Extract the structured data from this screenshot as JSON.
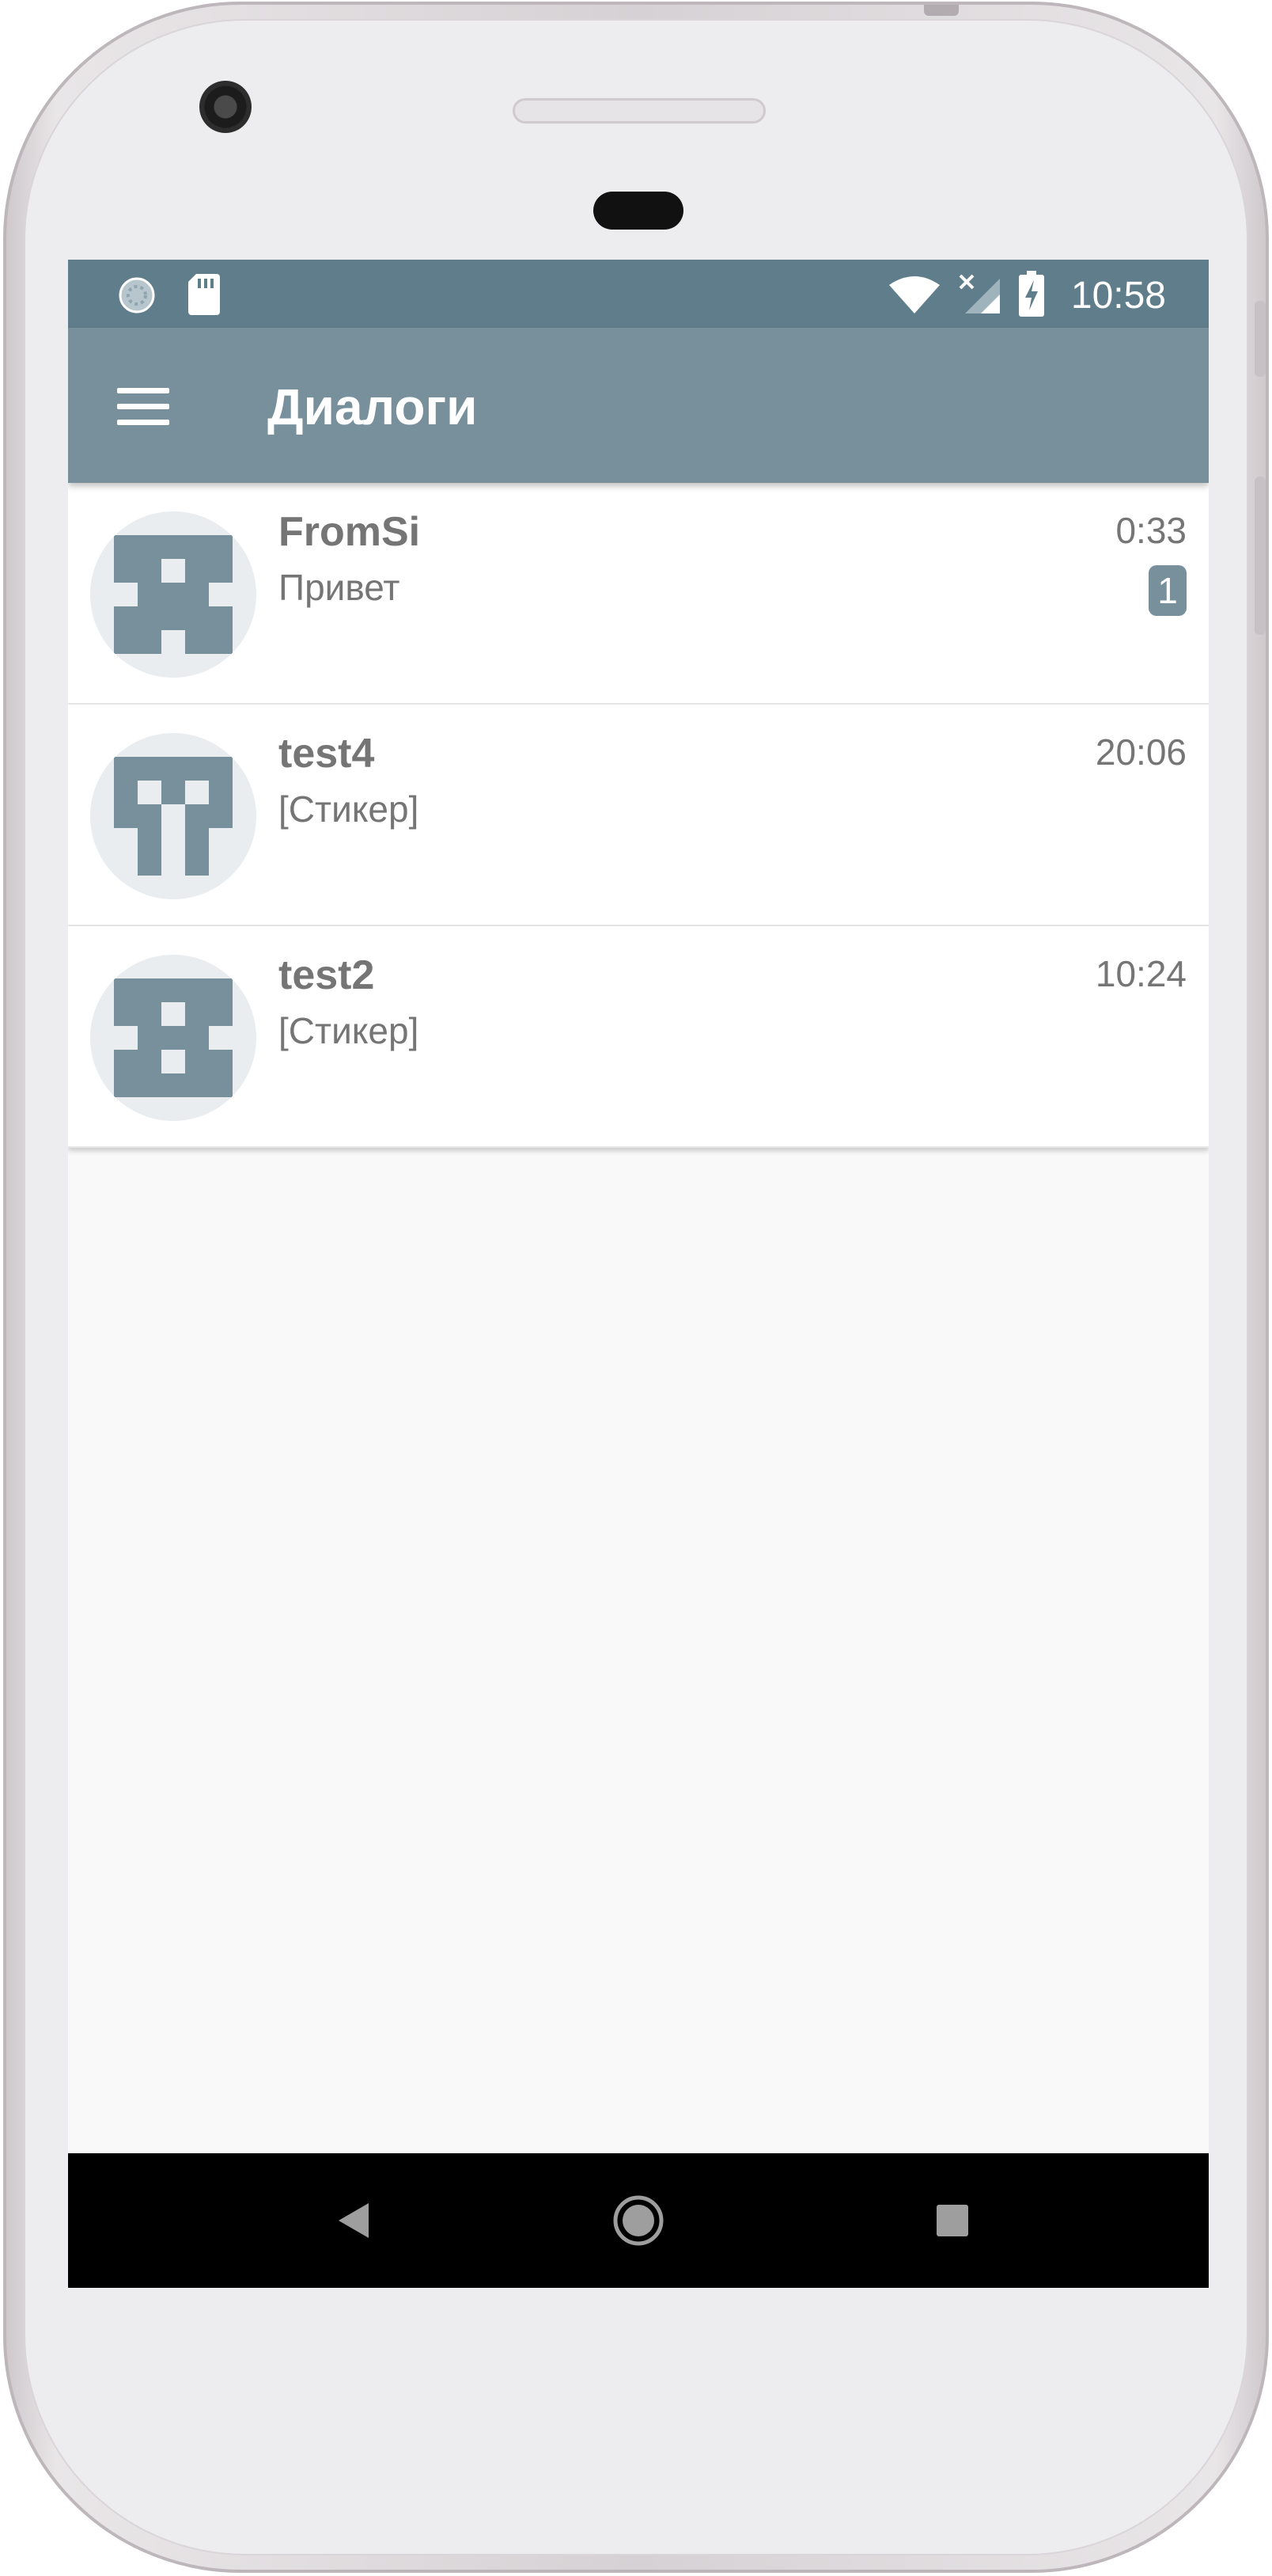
{
  "status_bar": {
    "time": "10:58",
    "icons": [
      "sync-icon",
      "sd-card-icon",
      "wifi-icon",
      "signal-icon",
      "battery-charging-icon"
    ]
  },
  "app_bar": {
    "menu_icon": "hamburger-menu-icon",
    "title": "Диалоги"
  },
  "dialogs": [
    {
      "name": "FromSi",
      "preview": "Привет",
      "time": "0:33",
      "unread": "1",
      "avatar": "identicon-a"
    },
    {
      "name": "test4",
      "preview": "[Стикер]",
      "time": "20:06",
      "unread": "",
      "avatar": "identicon-b"
    },
    {
      "name": "test2",
      "preview": "[Стикер]",
      "time": "10:24",
      "unread": "",
      "avatar": "identicon-c"
    }
  ],
  "nav_bar": {
    "buttons": [
      "back-icon",
      "home-icon",
      "recents-icon"
    ]
  },
  "colors": {
    "status_bar": "#607d8b",
    "app_bar": "#78909c",
    "text_secondary": "#757575",
    "avatar_bg": "#e9edf0",
    "avatar_fg": "#78909c"
  }
}
